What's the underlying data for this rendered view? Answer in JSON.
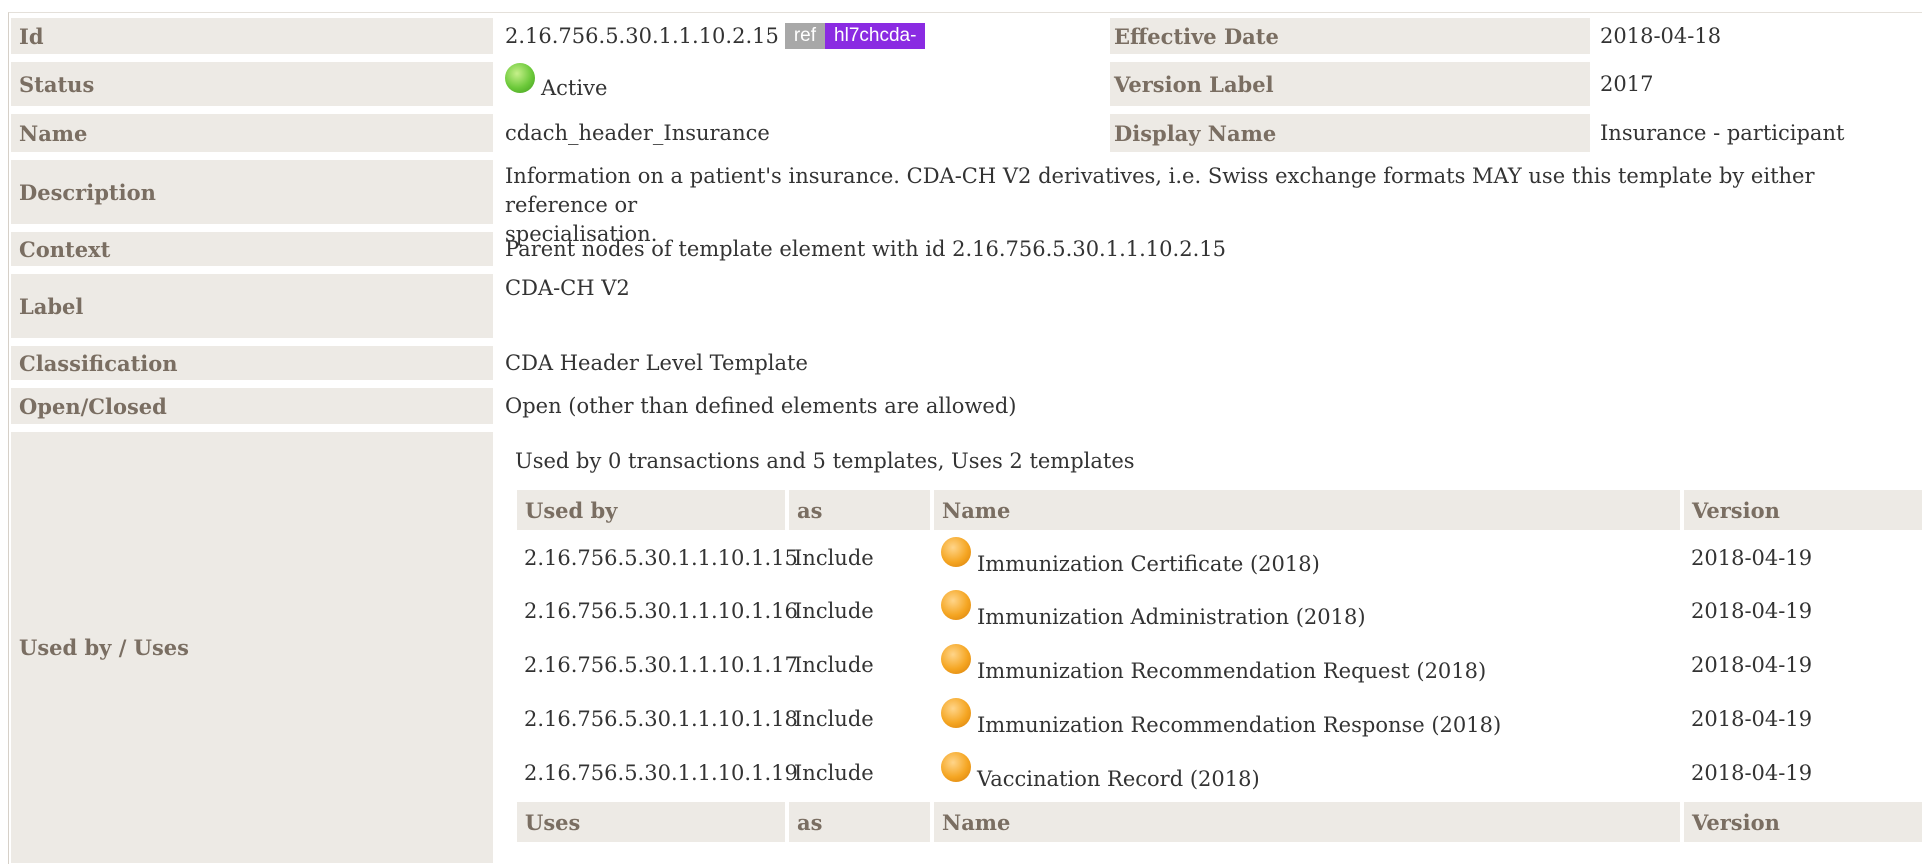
{
  "fields": {
    "id": {
      "label": "Id",
      "value": "2.16.756.5.30.1.1.10.2.15",
      "tag_ref": "ref",
      "tag_prefix": "hl7chcda-"
    },
    "effective_date": {
      "label": "Effective Date",
      "value": "2018-04-18"
    },
    "status": {
      "label": "Status",
      "value": "Active",
      "status_color": "#6cc93a"
    },
    "version_label": {
      "label": "Version Label",
      "value": "2017"
    },
    "name": {
      "label": "Name",
      "value": "cdach_header_Insurance"
    },
    "display_name": {
      "label": "Display Name",
      "value": "Insurance - participant"
    },
    "description": {
      "label": "Description",
      "value_line1": "Information on a patient's insurance. CDA-CH V2 derivatives, i.e. Swiss exchange formats MAY use this template by either reference or",
      "value_line2": "specialisation."
    },
    "context": {
      "label": "Context",
      "value": "Parent nodes of template element with id 2.16.756.5.30.1.1.10.2.15"
    },
    "label": {
      "label": "Label",
      "value": "CDA-CH V2"
    },
    "classification": {
      "label": "Classification",
      "value": "CDA Header Level Template"
    },
    "open_closed": {
      "label": "Open/Closed",
      "value": "Open (other than defined elements are allowed)"
    },
    "used_by_uses": {
      "label": "Used by / Uses"
    }
  },
  "usage": {
    "summary": "Used by 0 transactions and 5 templates, Uses 2 templates",
    "used_by_header": {
      "col1": "Used by",
      "col2": "as",
      "col3": "Name",
      "col4": "Version"
    },
    "rows": [
      {
        "id": "2.16.756.5.30.1.1.10.1.15",
        "as": "Include",
        "name": "Immunization Certificate (2018)",
        "version": "2018-04-19"
      },
      {
        "id": "2.16.756.5.30.1.1.10.1.16",
        "as": "Include",
        "name": "Immunization Administration (2018)",
        "version": "2018-04-19"
      },
      {
        "id": "2.16.756.5.30.1.1.10.1.17",
        "as": "Include",
        "name": "Immunization Recommendation Request (2018)",
        "version": "2018-04-19"
      },
      {
        "id": "2.16.756.5.30.1.1.10.1.18",
        "as": "Include",
        "name": "Immunization Recommendation Response (2018)",
        "version": "2018-04-19"
      },
      {
        "id": "2.16.756.5.30.1.1.10.1.19",
        "as": "Include",
        "name": "Vaccination Record (2018)",
        "version": "2018-04-19"
      }
    ],
    "row_status_color": "#f5a623",
    "uses_header": {
      "col1": "Uses",
      "col2": "as",
      "col3": "Name",
      "col4": "Version"
    }
  }
}
